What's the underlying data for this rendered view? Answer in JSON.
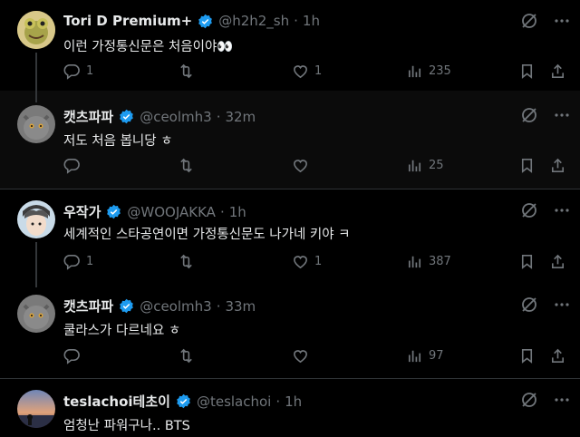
{
  "posts": [
    {
      "name": "Tori D Premium+",
      "handle": "@h2h2_sh",
      "time": "1h",
      "text": "이런 가정통신문은 처음이야👀",
      "replies": "1",
      "likes": "1",
      "views": "235"
    },
    {
      "name": "캣츠파파",
      "handle": "@ceolmh3",
      "time": "32m",
      "text": "저도 처음 봅니당 ㅎ",
      "replies": "",
      "likes": "",
      "views": "25"
    },
    {
      "name": "우작가",
      "handle": "@WOOJAKKA",
      "time": "1h",
      "text": "세계적인 스타공연이면 가정통신문도 나가네 키야 ㅋ",
      "replies": "1",
      "likes": "1",
      "views": "387"
    },
    {
      "name": "캣츠파파",
      "handle": "@ceolmh3",
      "time": "33m",
      "text": "쿨라스가 다르네요 ㅎ",
      "replies": "",
      "likes": "",
      "views": "97"
    },
    {
      "name": "teslachoi테초이",
      "handle": "@teslachoi",
      "time": "1h",
      "text": "엄청난 파워구나.. BTS",
      "replies": "",
      "likes": "",
      "views": ""
    }
  ],
  "icons": {
    "reply": "reply-icon",
    "retweet": "retweet-icon",
    "like": "like-icon",
    "views": "views-icon",
    "bookmark": "bookmark-icon",
    "share": "share-icon",
    "grok": "grok-icon",
    "more": "more-icon",
    "verified": "verified-badge"
  },
  "colors": {
    "verified": "#1d9bf0",
    "muted": "#71767b",
    "text": "#e7e9ea"
  }
}
